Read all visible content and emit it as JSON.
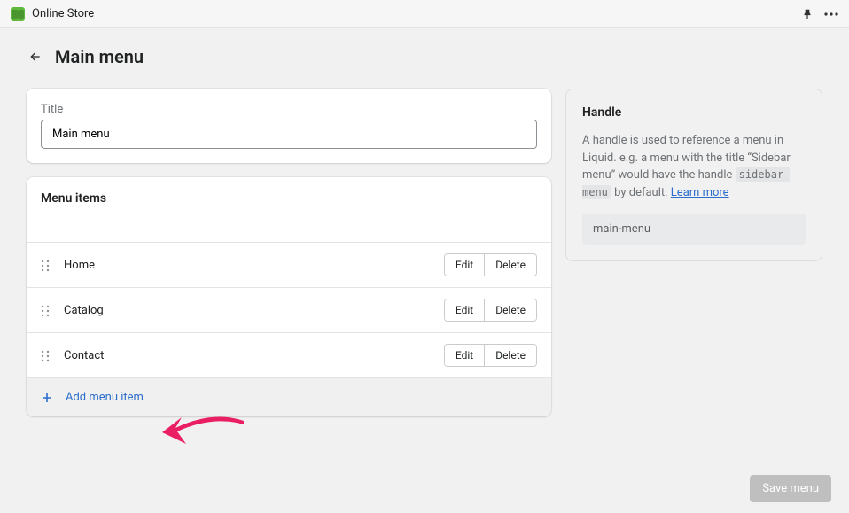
{
  "topbar": {
    "app_name": "Online Store"
  },
  "header": {
    "title": "Main menu"
  },
  "title_card": {
    "label": "Title",
    "value": "Main menu"
  },
  "menu_section": {
    "heading": "Menu items",
    "items": [
      {
        "label": "Home",
        "edit": "Edit",
        "delete": "Delete"
      },
      {
        "label": "Catalog",
        "edit": "Edit",
        "delete": "Delete"
      },
      {
        "label": "Contact",
        "edit": "Edit",
        "delete": "Delete"
      }
    ],
    "add_label": "Add menu item"
  },
  "handle_card": {
    "title": "Handle",
    "desc_pre": "A handle is used to reference a menu in Liquid. e.g. a menu with the title “Sidebar menu” would have the handle ",
    "code": "sidebar-menu",
    "desc_post": " by default. ",
    "learn_more": "Learn more",
    "value": "main-menu"
  },
  "footer": {
    "save": "Save menu"
  }
}
